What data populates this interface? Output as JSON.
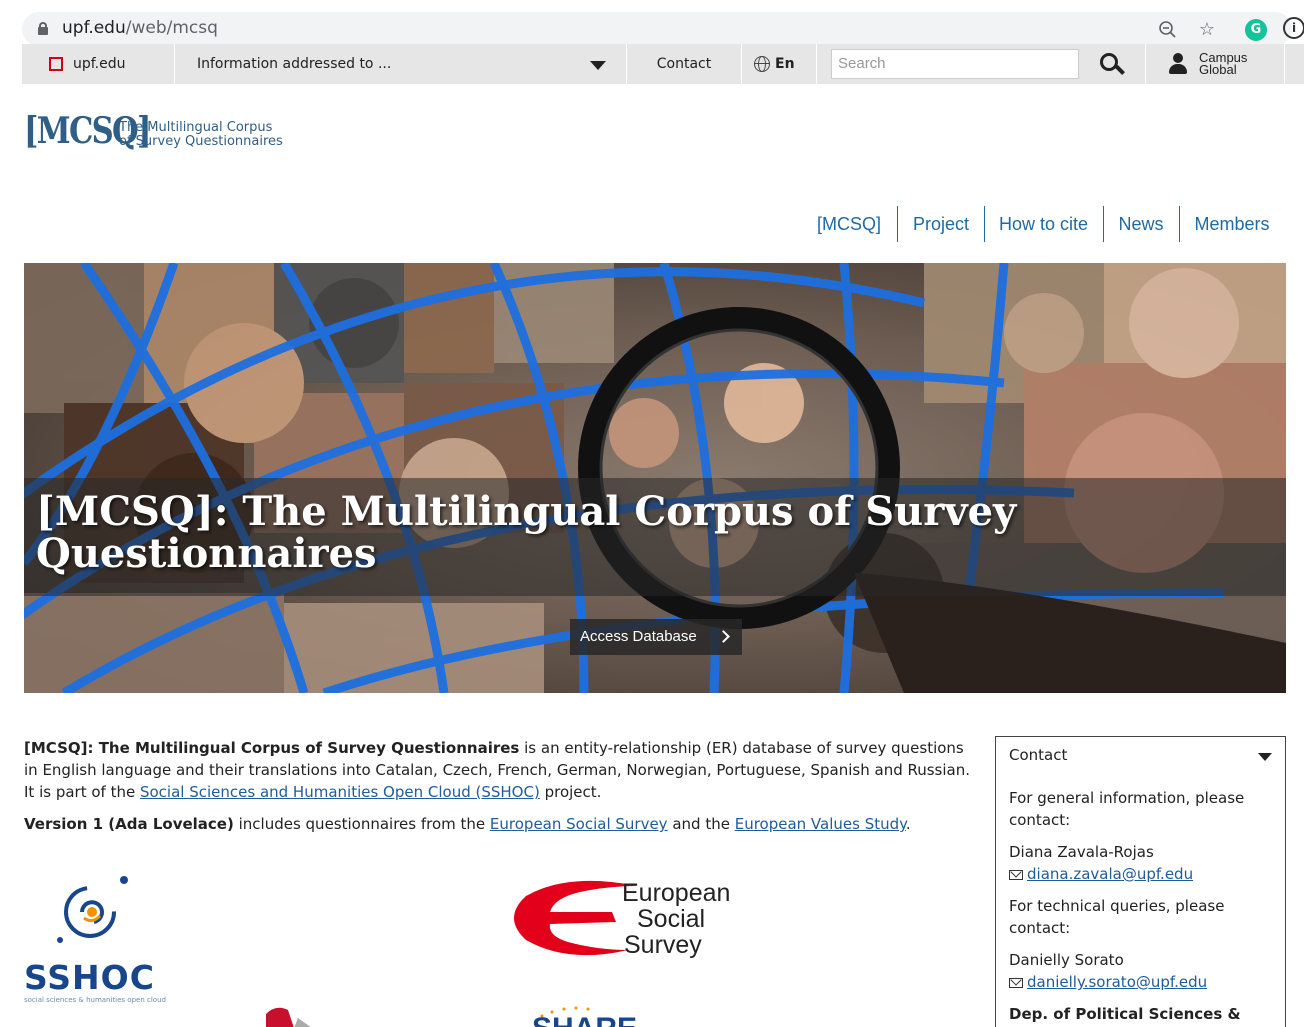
{
  "browser": {
    "url_host": "upf.edu",
    "url_path": "/web/mcsq",
    "grammarly_letter": "G",
    "info_glyph": "i"
  },
  "topbar": {
    "home_label": "upf.edu",
    "audience_label": "Information addressed to ...",
    "contact_label": "Contact",
    "language_label": "En",
    "search_placeholder": "Search",
    "campus_line1": "Campus",
    "campus_line2": "Global"
  },
  "logo": {
    "mark": "[MCSQ]",
    "line1": "The Multilingual Corpus",
    "line2": "of Survey Questionnaires"
  },
  "nav": {
    "items": [
      {
        "label": "[MCSQ]"
      },
      {
        "label": "Project"
      },
      {
        "label": "How to cite"
      },
      {
        "label": "News"
      },
      {
        "label": "Members"
      }
    ]
  },
  "hero": {
    "title": "[MCSQ]: The Multilingual Corpus of Survey Questionnaires",
    "button_label": "Access Database"
  },
  "intro": {
    "p1_bold": "[MCSQ]: The Multilingual Corpus of Survey Questionnaires",
    "p1_text": " is an entity-relationship (ER) database of survey questions in English language and their translations into Catalan, Czech, French, German, Norwegian, Portuguese, Spanish and Russian. It is part of the ",
    "p1_link": "Social Sciences and Humanities Open Cloud (SSHOC)",
    "p1_end": " project.",
    "p2_bold": "Version 1 (Ada Lovelace)",
    "p2_text": " includes questionnaires from the ",
    "p2_link1": "European Social Survey",
    "p2_mid": " and the ",
    "p2_link2": "European Values Study",
    "p2_end": "."
  },
  "partners": {
    "sshoc_word": "SSHOC",
    "sshoc_sub": "social sciences & humanities open cloud",
    "ess_line1": "European",
    "ess_line2": "Social",
    "ess_line3": "Survey",
    "share_partial": "SHARE"
  },
  "contact": {
    "heading": "Contact",
    "general_info": "For general information, please contact:",
    "person1_name": "Diana Zavala-Rojas",
    "person1_email": "diana.zavala@upf.edu",
    "technical_info": "For technical queries, please contact:",
    "person2_name": "Danielly Sorato",
    "person2_email": "danielly.sorato@upf.edu",
    "dept": "Dep. of Political Sciences &"
  },
  "colors": {
    "brand_blue": "#2f5e87",
    "link_blue": "#1f6aa5",
    "upf_red": "#d0021b",
    "ess_red": "#e3001b",
    "sshoc_blue": "#17468a",
    "sshoc_orange": "#f39200"
  }
}
